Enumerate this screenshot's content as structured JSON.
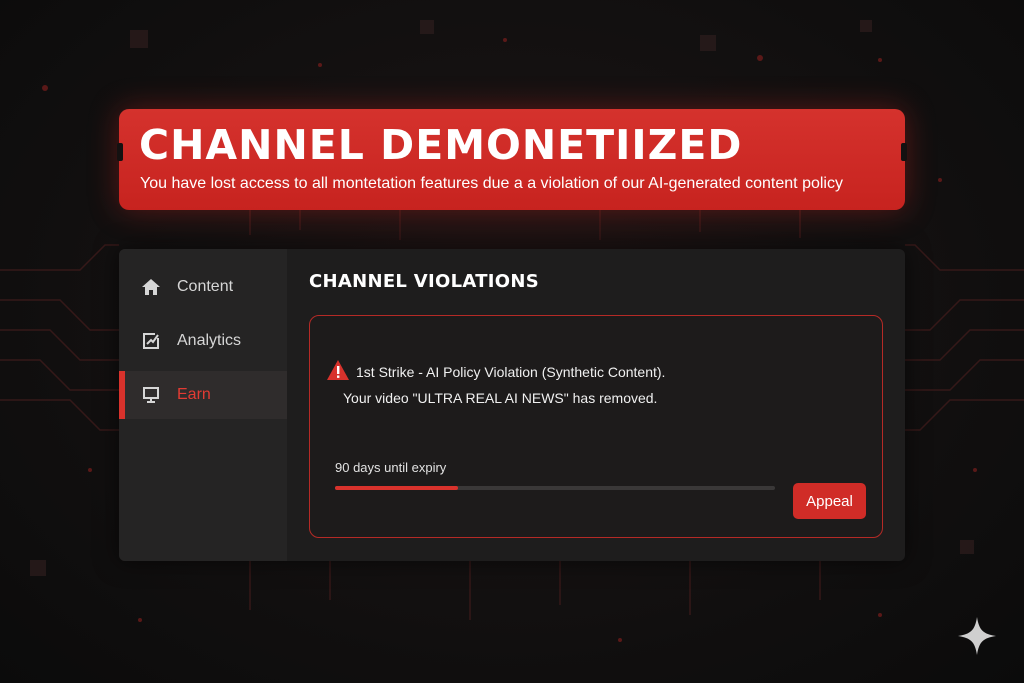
{
  "banner": {
    "title": "CHANNEL DEMONETIIZED",
    "subtitle": "You have lost access to all montetation features due a a violation of our AI-generated content policy"
  },
  "sidebar": {
    "items": [
      {
        "label": "Content",
        "icon": "home-icon",
        "active": false
      },
      {
        "label": "Analytics",
        "icon": "analytics-icon",
        "active": false
      },
      {
        "label": "Earn",
        "icon": "monitor-icon",
        "active": true
      }
    ]
  },
  "main": {
    "section_title": "CHANNEL VIOLATIONS",
    "violation": {
      "icon": "warning-icon",
      "strike": "1st Strike - AI Policy Violation (Synthetic Content).",
      "removed": "Your video \"ULTRA REAL AI NEWS\" has removed.",
      "expiry": "90 days until expiry",
      "progress_fraction": 0.28,
      "appeal_label": "Appeal"
    }
  },
  "colors": {
    "accent": "#d8322c",
    "background": "#141111",
    "panel": "#1e1d1d",
    "sidebar": "#252424"
  },
  "watermark_icon": "sparkle-icon"
}
